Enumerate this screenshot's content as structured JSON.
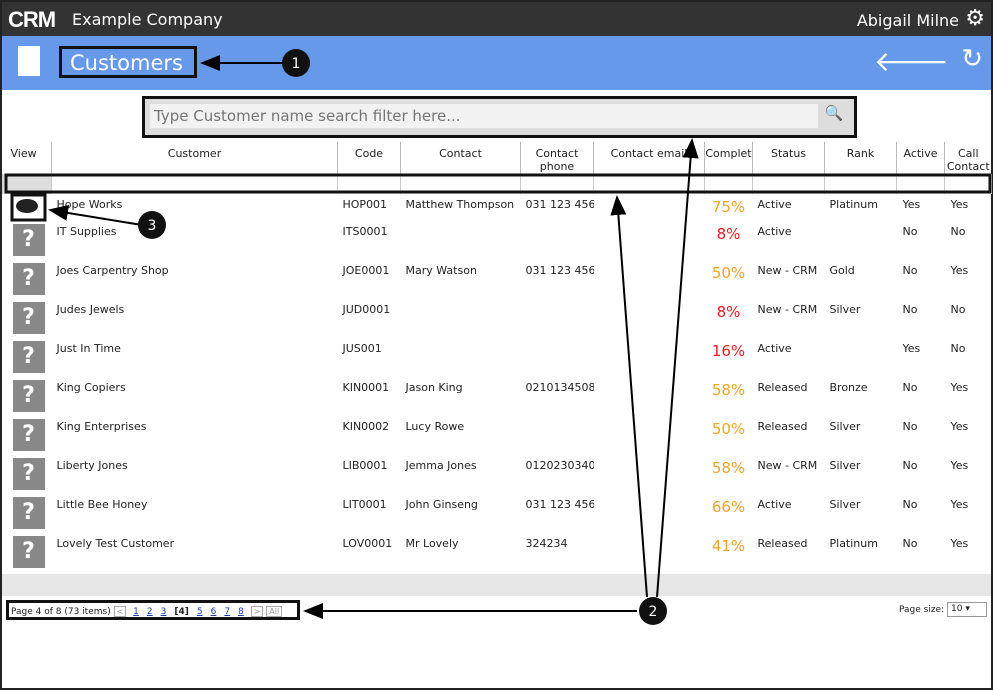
{
  "topbar": {
    "logo": "CRM",
    "company": "Example Company",
    "user": "Abigail Milne",
    "settings_icon": "gear-icon"
  },
  "header": {
    "title": "Customers",
    "back_icon": "arrow-left-icon",
    "refresh_icon": "refresh-icon"
  },
  "search": {
    "placeholder": "Type Customer name search filter here...",
    "value": ""
  },
  "columns": [
    "View",
    "Customer",
    "Code",
    "Contact",
    "Contact phone",
    "Contact email",
    "Complet",
    "Status",
    "Rank",
    "Active",
    "Call Contact"
  ],
  "rows": [
    {
      "customer": "Hope Works",
      "code": "HOP001",
      "contact": "Matthew Thompson",
      "phone": "031 123 456",
      "email": "",
      "complete": "75%",
      "status": "Active",
      "rank": "Platinum",
      "active": "Yes",
      "call": "Yes",
      "logo": true
    },
    {
      "customer": "IT Supplies",
      "code": "ITS0001",
      "contact": "",
      "phone": "",
      "email": "",
      "complete": "8%",
      "status": "Active",
      "rank": "",
      "active": "No",
      "call": "No"
    },
    {
      "customer": "Joes Carpentry Shop",
      "code": "JOE0001",
      "contact": "Mary Watson",
      "phone": "031 123 456",
      "email": "",
      "complete": "50%",
      "status": "New - CRM",
      "rank": "Gold",
      "active": "No",
      "call": "Yes"
    },
    {
      "customer": "Judes Jewels",
      "code": "JUD0001",
      "contact": "",
      "phone": "",
      "email": "",
      "complete": "8%",
      "status": "New - CRM",
      "rank": "Silver",
      "active": "No",
      "call": "No"
    },
    {
      "customer": "Just In Time",
      "code": "JUS001",
      "contact": "",
      "phone": "",
      "email": "",
      "complete": "16%",
      "status": "Active",
      "rank": "",
      "active": "Yes",
      "call": "No"
    },
    {
      "customer": "King Copiers",
      "code": "KIN0001",
      "contact": "Jason King",
      "phone": "0210134508",
      "email": "",
      "complete": "58%",
      "status": "Released",
      "rank": "Bronze",
      "active": "No",
      "call": "Yes"
    },
    {
      "customer": "King Enterprises",
      "code": "KIN0002",
      "contact": "Lucy Rowe",
      "phone": "",
      "email": "",
      "complete": "50%",
      "status": "Released",
      "rank": "Silver",
      "active": "No",
      "call": "Yes"
    },
    {
      "customer": "Liberty Jones",
      "code": "LIB0001",
      "contact": "Jemma Jones",
      "phone": "0120230340",
      "email": "",
      "complete": "58%",
      "status": "New - CRM",
      "rank": "Silver",
      "active": "No",
      "call": "Yes"
    },
    {
      "customer": "Little Bee Honey",
      "code": "LIT0001",
      "contact": "John Ginseng",
      "phone": "031 123 456",
      "email": "",
      "complete": "66%",
      "status": "Active",
      "rank": "Silver",
      "active": "No",
      "call": "Yes"
    },
    {
      "customer": "Lovely Test Customer",
      "code": "LOV0001",
      "contact": "Mr Lovely",
      "phone": "324234",
      "email": "",
      "complete": "41%",
      "status": "Released",
      "rank": "Platinum",
      "active": "No",
      "call": "Yes"
    }
  ],
  "pager": {
    "summary": "Page 4 of 8 (73 items)",
    "prev": "<",
    "pages": [
      "1",
      "2",
      "3",
      "[4]",
      "5",
      "6",
      "7",
      "8"
    ],
    "next": ">",
    "all": "All",
    "page_size_label": "Page size:",
    "page_size": "10"
  },
  "callouts": [
    "1",
    "2",
    "3"
  ],
  "colors": {
    "header": "#6799ea",
    "topbar": "#333333",
    "pct_high": "#f7a32b",
    "pct_low": "#e31e24"
  }
}
